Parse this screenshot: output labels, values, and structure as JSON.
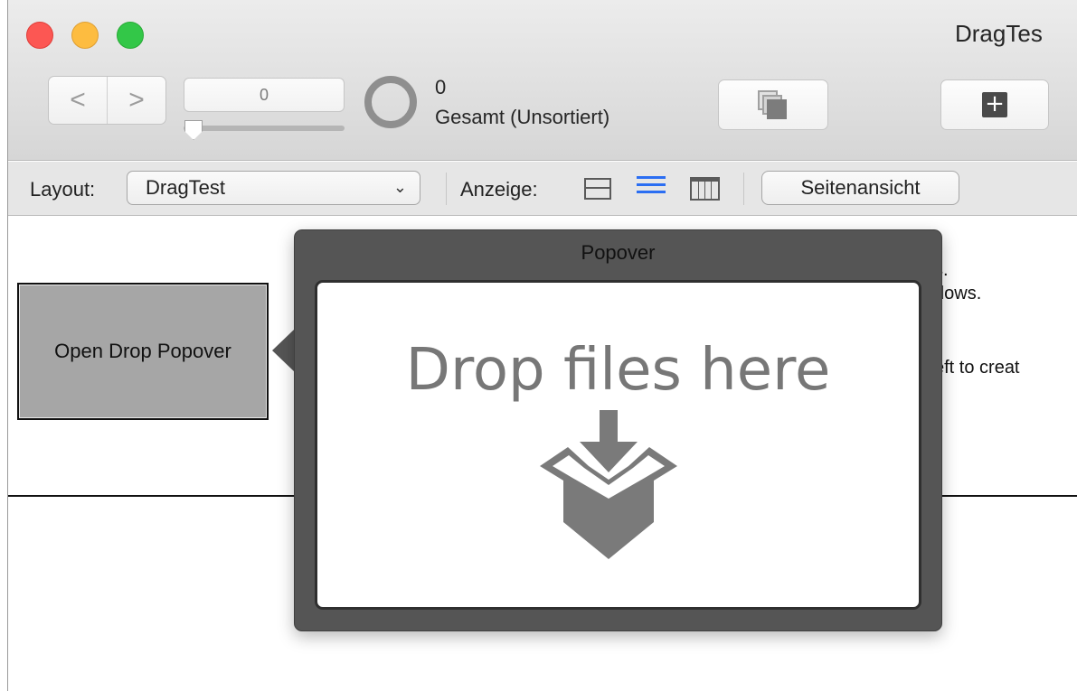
{
  "window": {
    "title": "DragTes"
  },
  "toolbar": {
    "back": "<",
    "forward": ">",
    "record_value": "0",
    "record_slider": 0,
    "found_count": "0",
    "found_label": "Gesamt (Unsortiert)",
    "new_record_icon": "+"
  },
  "layoutbar": {
    "layout_label": "Layout:",
    "layout_value": "DragTest",
    "view_label": "Anzeige:",
    "preview_button": "Seitenansicht",
    "selected_view": "list"
  },
  "content": {
    "open_button": "Open Drop Popover",
    "partial_text_1": "s.",
    "partial_text_2": "dows.",
    "partial_text_3": "eft to creat"
  },
  "popover": {
    "title": "Popover",
    "drop_text": "Drop files here",
    "icon": "download-box-icon"
  },
  "colors": {
    "close": "#fc5753",
    "minimize": "#fdbc40",
    "zoom": "#33c748",
    "popover_bg": "#555555",
    "selected_view": "#2b6ef2"
  }
}
